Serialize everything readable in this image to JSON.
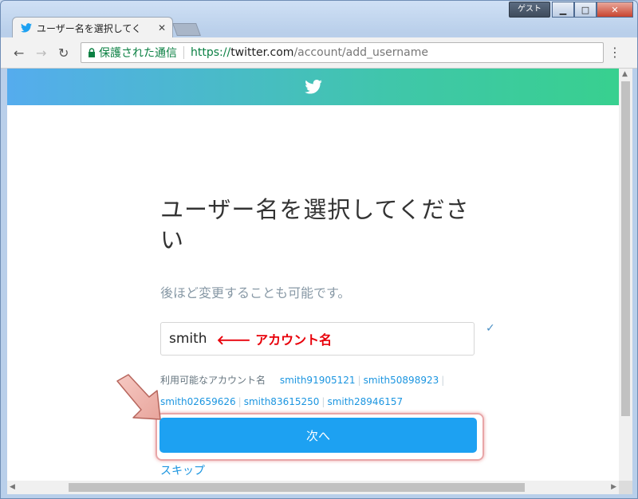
{
  "window": {
    "guest_label": "ゲスト"
  },
  "tab": {
    "title": "ユーザー名を選択してく"
  },
  "toolbar": {
    "secure_label": "保護された通信",
    "url_scheme": "https://",
    "url_host": "twitter.com",
    "url_path": "/account/add_username"
  },
  "page": {
    "heading_line1": "ユーザー名を選択してくださ",
    "heading_line2": "い",
    "subtext": "後ほど変更することも可能です。",
    "username_value": "smith",
    "annotation": "アカウント名",
    "suggestions_label": "利用可能なアカウント名",
    "suggestions": [
      "smith91905121",
      "smith50898923",
      "smith02659626",
      "smith83615250",
      "smith28946157"
    ],
    "next_button": "次へ",
    "skip_link": "スキップ"
  },
  "colors": {
    "twitter_blue": "#1da1f2",
    "annotation_red": "#e8000a",
    "link_blue": "#1b95e0"
  },
  "icons": [
    "twitter-bird-icon",
    "lock-icon",
    "back-icon",
    "forward-icon",
    "reload-icon",
    "menu-icon",
    "check-icon",
    "red-left-arrow-icon",
    "pointer-arrow-icon"
  ]
}
